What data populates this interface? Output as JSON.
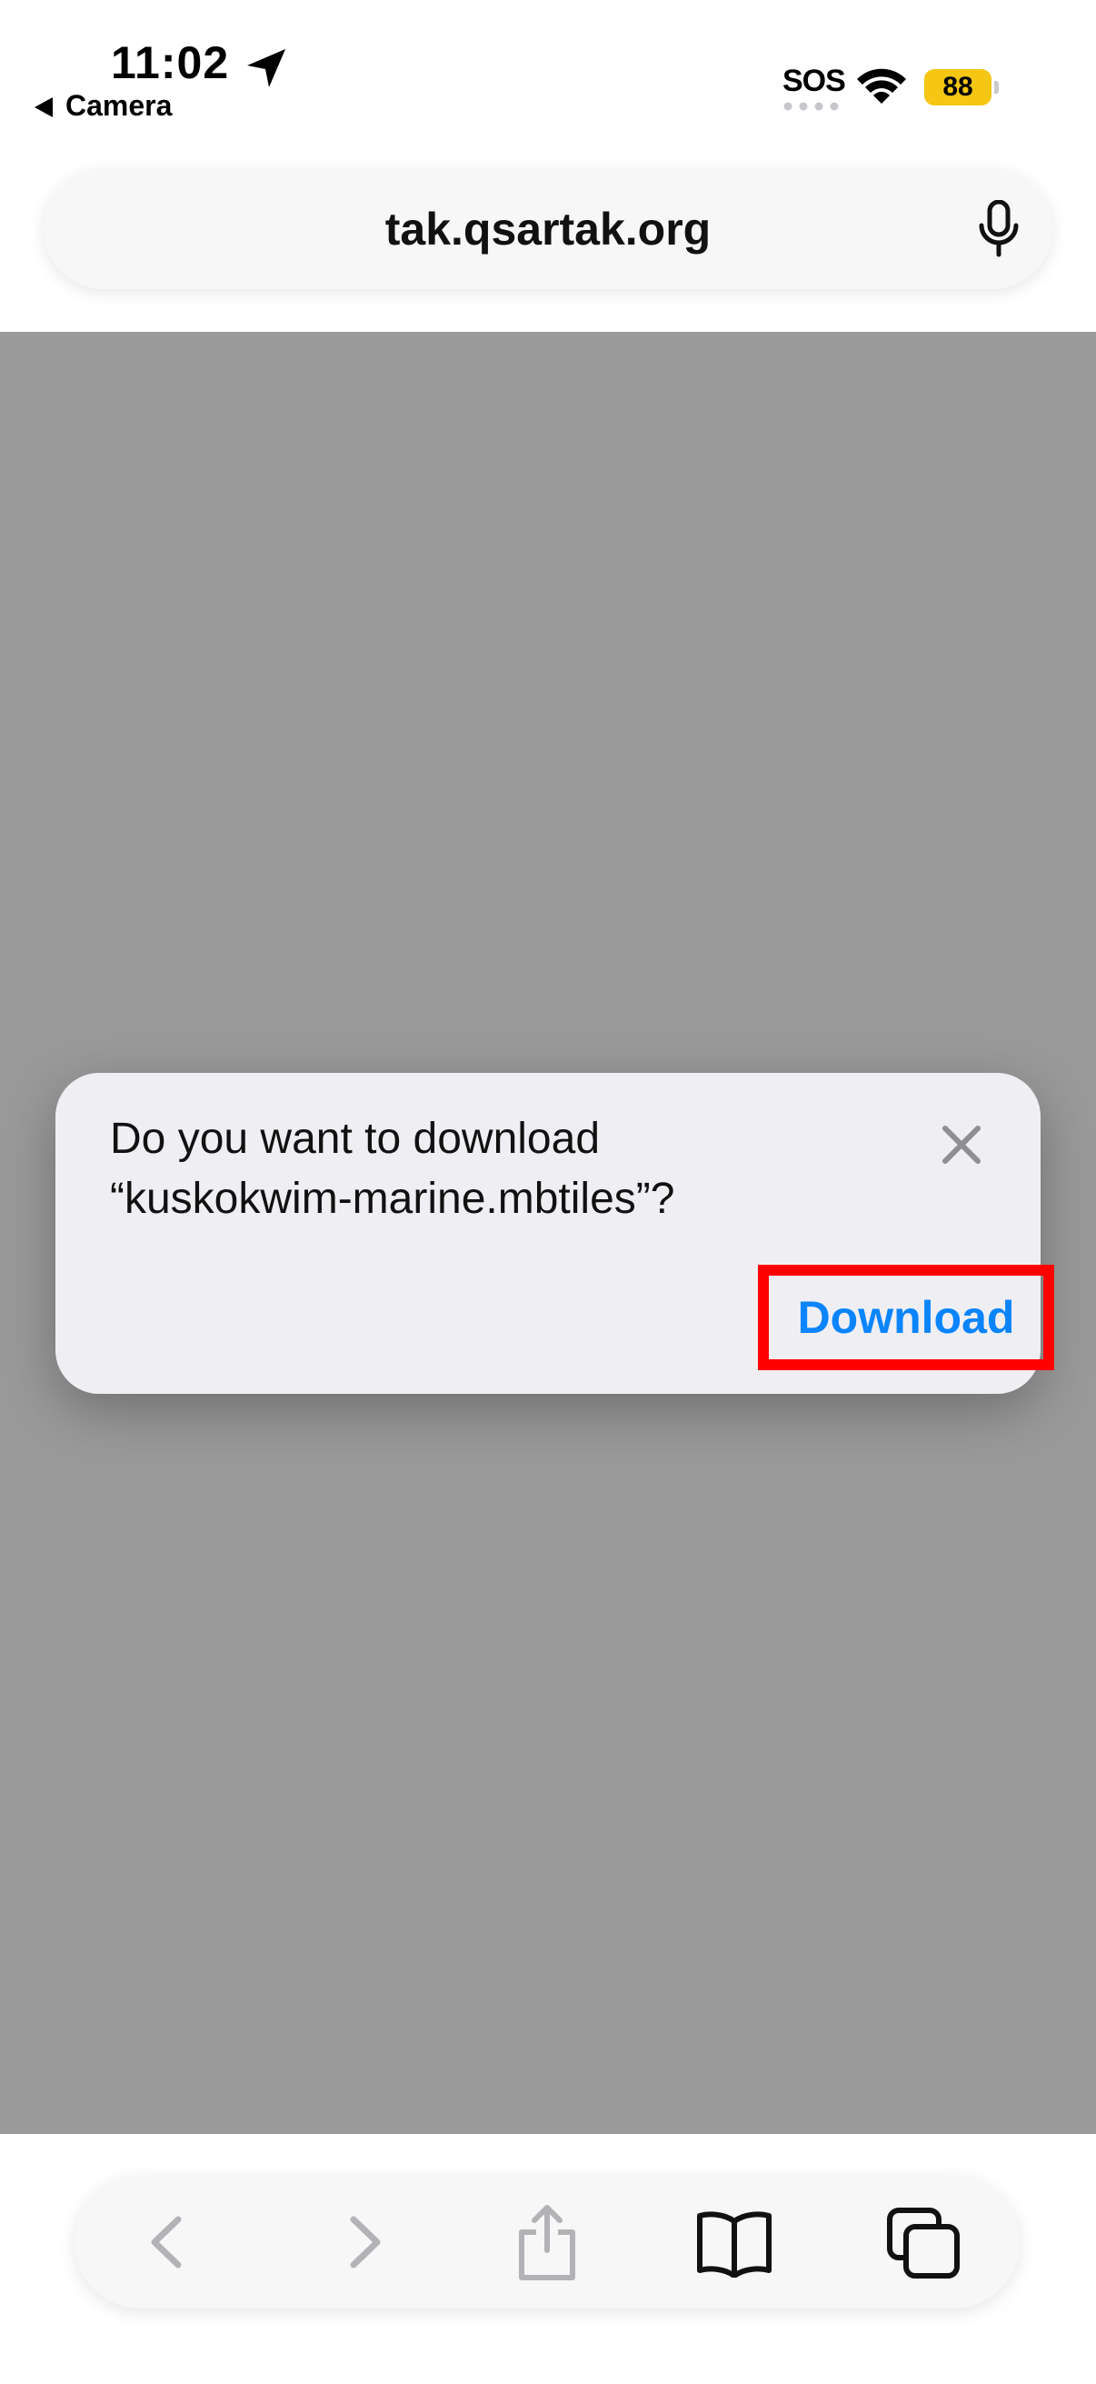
{
  "status_bar": {
    "time": "11:02",
    "back_app": "Camera",
    "sos": "SOS",
    "battery_level": "88",
    "colors": {
      "battery": "#f5c614"
    },
    "icons": [
      "location-arrow-icon",
      "back-caret-icon",
      "wifi-icon",
      "battery-icon"
    ]
  },
  "address_bar": {
    "url": "tak.qsartak.org",
    "icons": [
      "mic-icon"
    ]
  },
  "dialog": {
    "message_line1": "Do you want to download",
    "message_line2": "“kuskokwim-marine.mbtiles”?",
    "download_label": "Download",
    "icons": [
      "close-icon"
    ],
    "colors": {
      "action": "#0a84ff",
      "highlight": "#ff0000"
    }
  },
  "toolbar": {
    "icons": [
      "back-icon",
      "forward-icon",
      "share-icon",
      "bookmarks-icon",
      "tabs-icon"
    ]
  }
}
